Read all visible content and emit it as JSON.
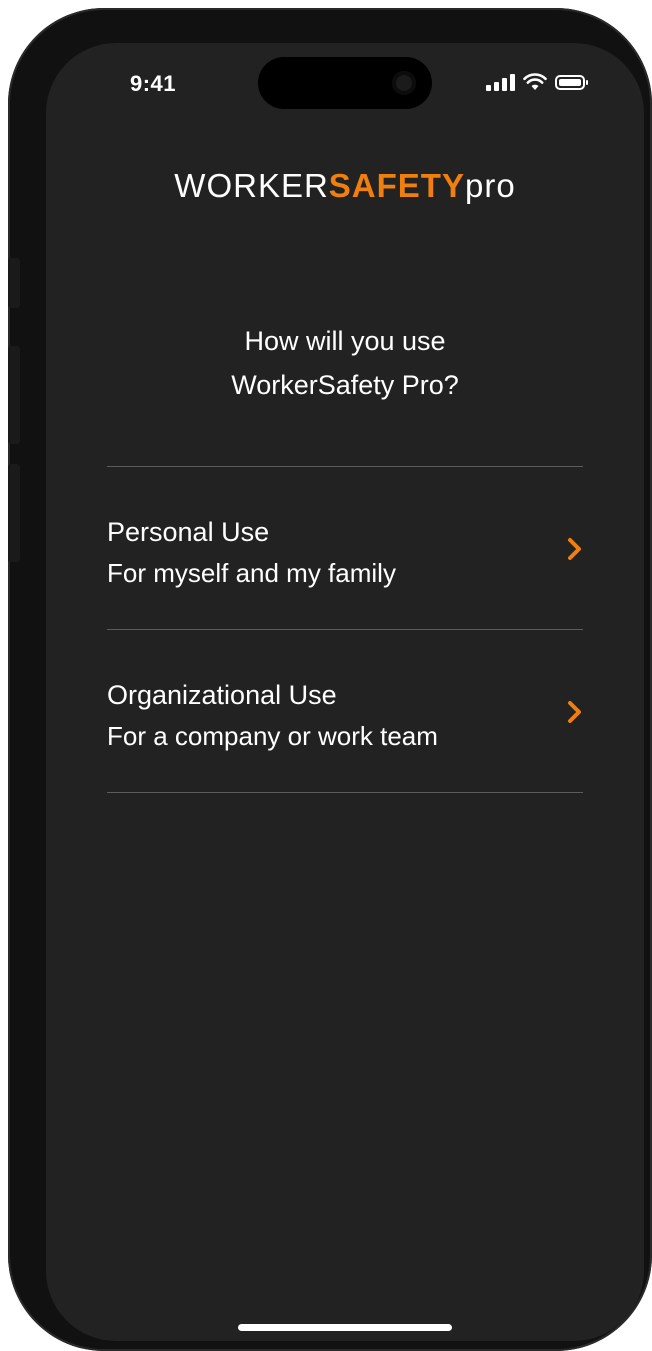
{
  "status_bar": {
    "time": "9:41"
  },
  "logo": {
    "part1": "WORKER",
    "part2": "SAFETY",
    "part3": "pro"
  },
  "question": {
    "line1": "How will you use",
    "line2": "WorkerSafety Pro?"
  },
  "options": [
    {
      "title": "Personal Use",
      "subtitle": "For myself and my family",
      "icon": "chevron-right-icon"
    },
    {
      "title": "Organizational Use",
      "subtitle": "For a company or work team",
      "icon": "chevron-right-icon"
    }
  ],
  "colors": {
    "accent": "#F07F10",
    "background": "#222222",
    "text": "#FFFFFF",
    "divider": "#5C5C5C"
  }
}
